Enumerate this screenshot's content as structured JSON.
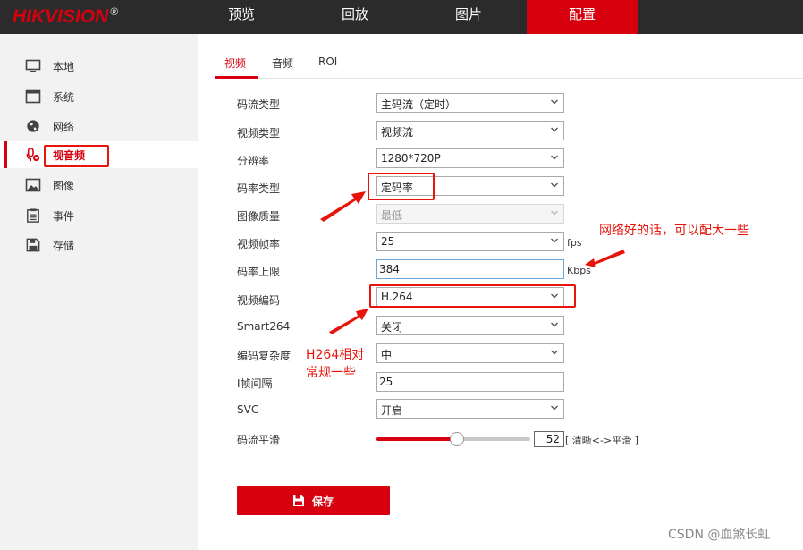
{
  "brand": {
    "name": "HIKVISION",
    "reg": "®"
  },
  "top_nav": [
    {
      "label": "预览",
      "active": false
    },
    {
      "label": "回放",
      "active": false
    },
    {
      "label": "图片",
      "active": false
    },
    {
      "label": "配置",
      "active": true
    }
  ],
  "sidebar": {
    "items": [
      {
        "label": "本地",
        "icon": "monitor-icon"
      },
      {
        "label": "系统",
        "icon": "system-icon"
      },
      {
        "label": "网络",
        "icon": "globe-icon"
      },
      {
        "label": "视音频",
        "icon": "microphone-icon",
        "active": true
      },
      {
        "label": "图像",
        "icon": "image-icon"
      },
      {
        "label": "事件",
        "icon": "event-list-icon"
      },
      {
        "label": "存储",
        "icon": "floppy-icon"
      }
    ]
  },
  "tabs": [
    {
      "label": "视频",
      "active": true
    },
    {
      "label": "音频",
      "active": false
    },
    {
      "label": "ROI",
      "active": false
    }
  ],
  "form": {
    "stream_type": {
      "label": "码流类型",
      "value": "主码流（定时）"
    },
    "video_type": {
      "label": "视频类型",
      "value": "视频流"
    },
    "resolution": {
      "label": "分辨率",
      "value": "1280*720P"
    },
    "bitrate_type": {
      "label": "码率类型",
      "value": "定码率"
    },
    "image_quality": {
      "label": "图像质量",
      "value": "最低",
      "disabled": true
    },
    "frame_rate": {
      "label": "视频帧率",
      "value": "25",
      "unit": "fps"
    },
    "max_bitrate": {
      "label": "码率上限",
      "value": "384",
      "unit": "Kbps"
    },
    "video_encoding": {
      "label": "视频编码",
      "value": "H.264"
    },
    "smart264": {
      "label": "Smart264",
      "value": "关闭"
    },
    "encoding_complexity": {
      "label": "编码复杂度",
      "value": "中"
    },
    "i_frame_interval": {
      "label": "I帧间隔",
      "value": "25"
    },
    "svc": {
      "label": "SVC",
      "value": "开启"
    },
    "smoothing": {
      "label": "码流平滑",
      "value": "52",
      "level_percent": 52,
      "hint": "[ 清晰<->平滑 ]"
    }
  },
  "save_label": "保存",
  "annotations": {
    "network_note": "网络好的话，可以配大一些",
    "h264_note_line1": "H264相对",
    "h264_note_line2": "常规一些",
    "color": "#e8140c"
  },
  "watermark": "CSDN @血煞长虹",
  "colors": {
    "accent": "#d7000f",
    "topbar": "#2b2b2b",
    "sidebar": "#f2f2f2"
  }
}
